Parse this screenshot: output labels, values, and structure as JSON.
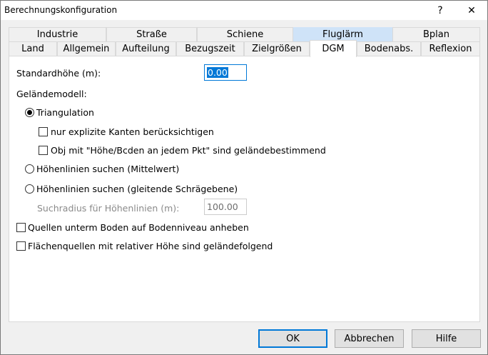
{
  "window": {
    "title": "Berechnungskonfiguration",
    "help_glyph": "?",
    "close_glyph": "✕"
  },
  "tabs_row1": [
    {
      "label": "Industrie",
      "state": "normal"
    },
    {
      "label": "Straße",
      "state": "normal"
    },
    {
      "label": "Schiene",
      "state": "normal"
    },
    {
      "label": "Fluglärm",
      "state": "highlighted"
    },
    {
      "label": "Bplan",
      "state": "normal"
    }
  ],
  "tabs_row2": [
    {
      "label": "Land",
      "state": "normal"
    },
    {
      "label": "Allgemein",
      "state": "normal"
    },
    {
      "label": "Aufteilung",
      "state": "normal"
    },
    {
      "label": "Bezugszeit",
      "state": "normal"
    },
    {
      "label": "Zielgrößen",
      "state": "normal"
    },
    {
      "label": "DGM",
      "state": "active"
    },
    {
      "label": "Bodenabs.",
      "state": "normal"
    },
    {
      "label": "Reflexion",
      "state": "normal"
    }
  ],
  "form": {
    "standard_height_label": "Standardhöhe (m):",
    "standard_height_value": "0.00",
    "terrain_model_label": "Geländemodell:",
    "triangulation": {
      "label": "Triangulation",
      "selected": true
    },
    "explicit_edges": {
      "label": "nur explizite Kanten berücksichtigen",
      "checked": false
    },
    "obj_height": {
      "label": "Obj mit \"Höhe/Bcden an jedem Pkt\" sind geländebestimmend",
      "checked": false
    },
    "contour_mean": {
      "label": "Höhenlinien suchen (Mittelwert)",
      "selected": false
    },
    "contour_slope": {
      "label": "Höhenlinien suchen (gleitende Schrägebene)",
      "selected": false
    },
    "search_radius_label": "Suchradius für Höhenlinien (m):",
    "search_radius_value": "100.00",
    "sources_ground": {
      "label": "Quellen unterm Boden auf Bodenniveau anheben",
      "checked": false
    },
    "area_sources": {
      "label": "Flächenquellen mit relativer Höhe sind geländefolgend",
      "checked": false
    }
  },
  "buttons": {
    "ok": "OK",
    "cancel": "Abbrechen",
    "help": "Hilfe"
  },
  "colors": {
    "accent": "#0078d7",
    "tab_highlight": "#cfe3f8",
    "panel": "#ffffff",
    "window": "#f0f0f0"
  }
}
